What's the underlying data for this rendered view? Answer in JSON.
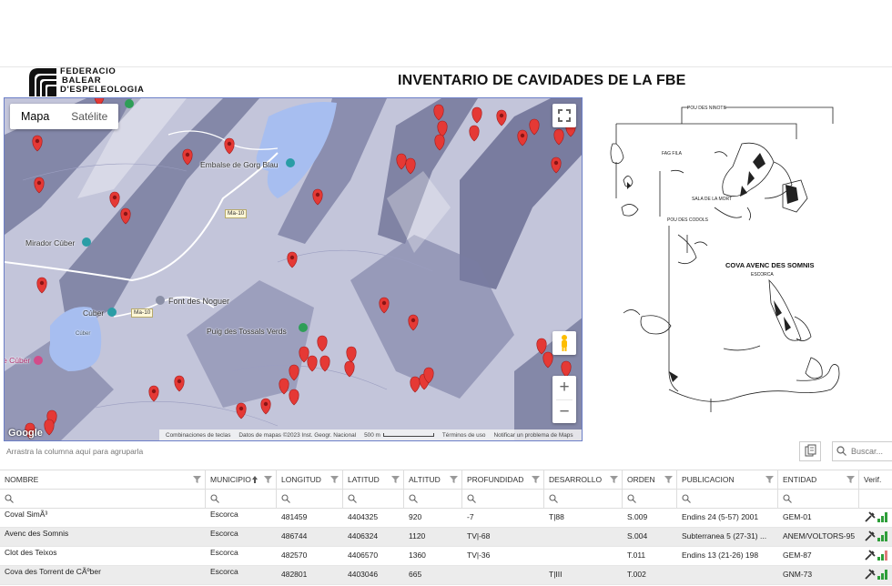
{
  "header": {
    "logo_lines": [
      "FEDERACIO",
      "BALEAR",
      "D'ESPELEOLOGIA"
    ],
    "title": "INVENTARIO DE CAVIDADES DE LA FBE"
  },
  "map": {
    "type_options": [
      {
        "label": "Mapa",
        "active": true
      },
      {
        "label": "Satélite",
        "active": false
      }
    ],
    "labels": {
      "embalse": "Embalse de Gorg Blau",
      "mirador": "Mirador Cúber",
      "font": "Font des Noguer",
      "cuber": "Cúber",
      "cuber_small": "Cúber",
      "puig": "Puig des Tossals Verds",
      "cuber_left": "e Cúber",
      "road1": "Ma-10",
      "road2": "Ma-10"
    },
    "footer": {
      "shortcuts": "Combinaciones de teclas",
      "data": "Datos de mapas ©2023 Inst. Geogr. Nacional",
      "scale": "500 m",
      "terms": "Términos de uso",
      "report": "Notificar un problema de Maps"
    },
    "google": "Google",
    "marker_color": "#e53935"
  },
  "grid": {
    "group_hint": "Arrastra la columna aquí para agruparla",
    "search_placeholder": "Buscar...",
    "columns": [
      "NOMBRE",
      "MUNICIPIO",
      "LONGITUD",
      "LATITUD",
      "ALTITUD",
      "PROFUNDIDAD",
      "DESARROLLO",
      "ORDEN",
      "PUBLICACION",
      "ENTIDAD",
      "Verif."
    ],
    "rows": [
      {
        "nombre": "Coval SimÃ³",
        "municipio": "Escorca",
        "longitud": "481459",
        "latitud": "4404325",
        "altitud": "920",
        "profundidad": "-7",
        "desarrollo": "T|88",
        "orden": "S.009",
        "publicacion": "Endins 24 (5-57) 2001",
        "entidad": "GEM-01"
      },
      {
        "nombre": "Avenc des Somnis",
        "municipio": "Escorca",
        "longitud": "486744",
        "latitud": "4406324",
        "altitud": "1120",
        "profundidad": "TV|-68",
        "desarrollo": "",
        "orden": "S.004",
        "publicacion": "Subterranea 5 (27-31) ...",
        "entidad": "ANEM/VOLTORS-95"
      },
      {
        "nombre": "Clot des Teixos",
        "municipio": "Escorca",
        "longitud": "482570",
        "latitud": "4406570",
        "altitud": "1360",
        "profundidad": "TV|-36",
        "desarrollo": "",
        "orden": "T.011",
        "publicacion": "Endins 13 (21-26) 198",
        "entidad": "GEM-87"
      },
      {
        "nombre": "Cova des Torrent de CÃºber",
        "municipio": "Escorca",
        "longitud": "482801",
        "latitud": "4403046",
        "altitud": "665",
        "profundidad": "",
        "desarrollo": "T|III",
        "orden": "T.002",
        "publicacion": "",
        "entidad": "GNM-73"
      }
    ]
  },
  "survey": {
    "title": "COVA AVENC DES SOMNIS",
    "subtitle": "ESCORCA",
    "labels": [
      "POU DES NINOTS",
      "FAG FILA",
      "SALA DE LA MORT",
      "POU DES CODOLS"
    ]
  }
}
